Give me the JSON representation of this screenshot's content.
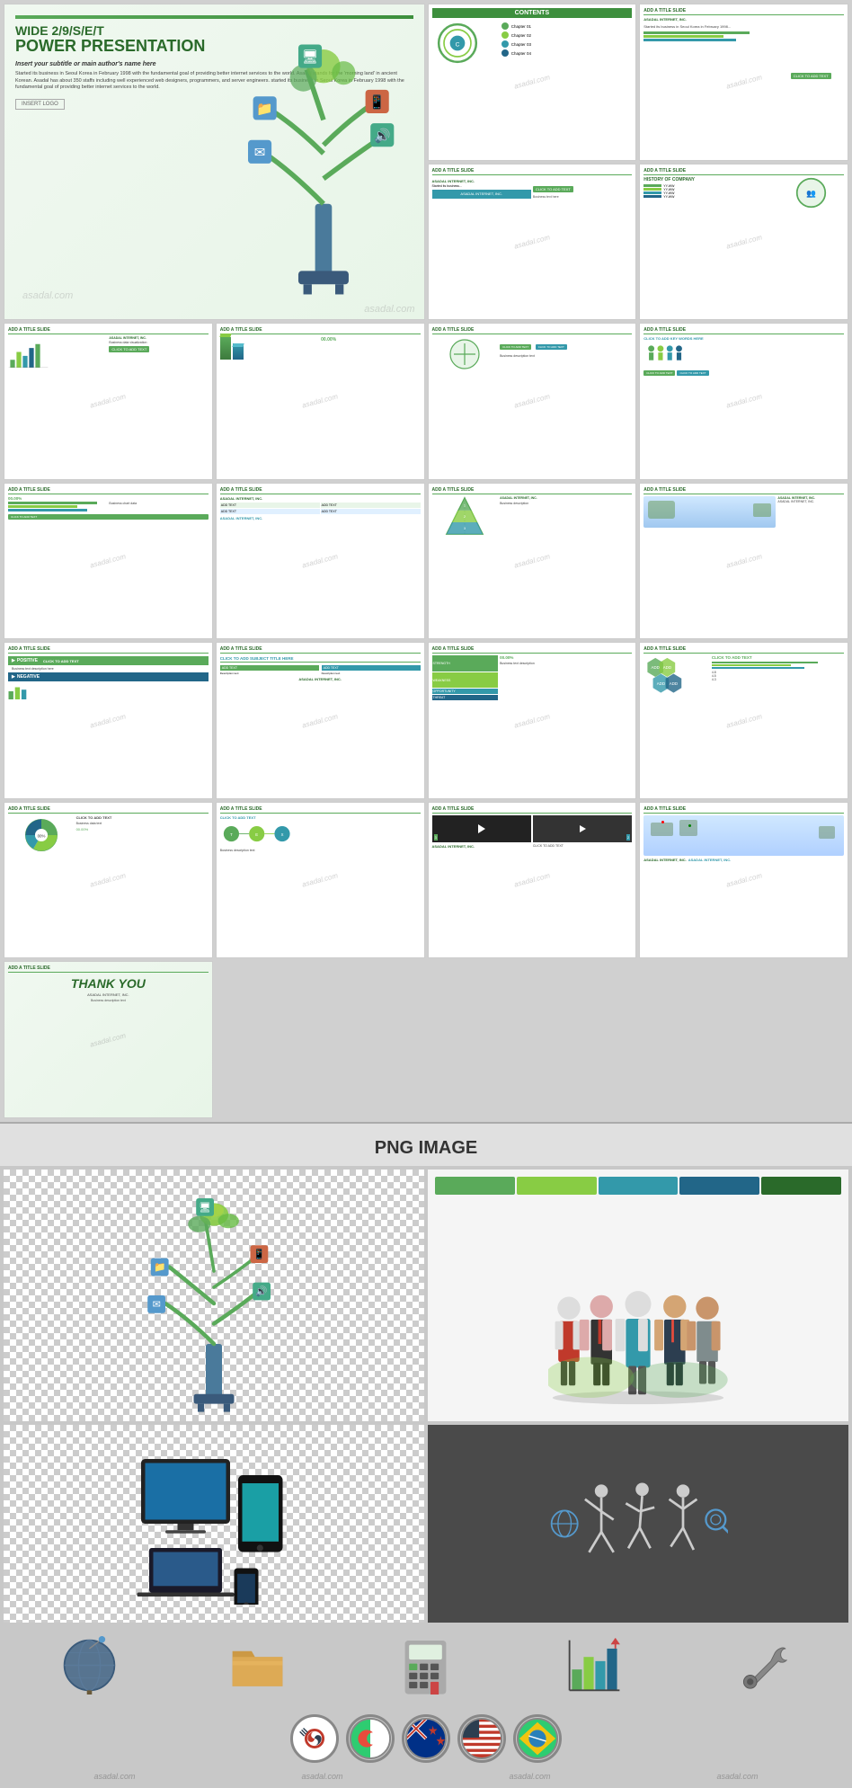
{
  "title": "Wide 2/9/S/E/T Power Presentation",
  "hero": {
    "tag": "WIDE 2/9/S/E/T",
    "title": "POWER PRESENTATION",
    "subtitle": "Insert your subtitle or main author's name here",
    "desc": "Started its business in Seoul Korea in February 1998 with the fundamental goal of providing better internet services to the world. Asadal stands for the 'morning land' in ancient Korean. Asadal has about 350 staffs including well experienced web designers, programmers, and server engineers. started its business in Seoul Korea in February 1998 with the fundamental goal of providing better internet services to the world.",
    "logo": "INSERT LOGO"
  },
  "slides": {
    "slide2_title": "CONTENTS",
    "add_title": "ADD A TITLE SLIDE",
    "company": "ASADAL INTERNET, INC.",
    "click_text": "CLICK TO ADD TEXT",
    "thank_you": "THANK YOU",
    "chapter_labels": [
      "Chapter 01",
      "Chapter 02",
      "Chapter 03",
      "Chapter 04"
    ],
    "positive": "POSITIVE",
    "negative": "NEGATIVE",
    "swot_labels": [
      "STRENGTH",
      "WEAKNESS",
      "OPPORTUNITY",
      "THREAT"
    ],
    "add_text": "ADD TEXT",
    "key_words": "CLICK TO ADD KEY WORDS HERE",
    "subject_title": "CLICK TO ADD SUBJECT TITLE HERE",
    "history": "HISTORY OF COMPANY",
    "percent_values": [
      "00.00%",
      "00.00%"
    ],
    "chart_value": "00.00%"
  },
  "png_section": {
    "label": "PNG IMAGE",
    "tree_description": "Technology tree with icons",
    "people_description": "Business people group",
    "devices_description": "Digital devices",
    "icons_description": "Business icons set"
  },
  "watermarks": [
    "asadal.com",
    "asadal.com",
    "asadal.com",
    "asadal.com"
  ],
  "flags": [
    {
      "label": "KR",
      "color1": "#c0392b",
      "color2": "#2c3e50"
    },
    {
      "label": "DZ",
      "color1": "#2ecc71",
      "color2": "#e74c3c"
    },
    {
      "label": "NZ",
      "color1": "#003087",
      "color2": "#c0392b"
    },
    {
      "label": "US",
      "color1": "#c0392b",
      "color2": "#2c3e50"
    },
    {
      "label": "BR",
      "color1": "#2ecc71",
      "color2": "#f39c12"
    }
  ]
}
